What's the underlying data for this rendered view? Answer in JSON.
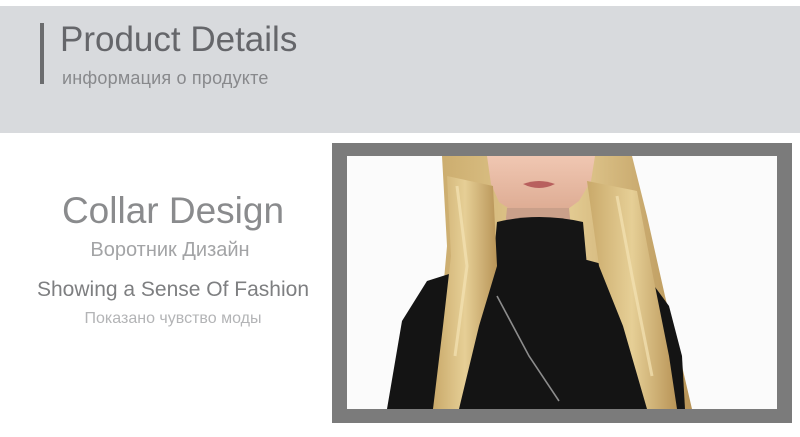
{
  "header": {
    "title": "Product Details",
    "subtitle": "информация о продукте"
  },
  "feature": {
    "title": "Collar Design",
    "subtitle": "Воротник Дизайн",
    "tagline": "Showing a Sense Of Fashion",
    "tagline_sub": "Показано чувство моды"
  },
  "colors": {
    "header_background": "#d8dadd",
    "frame": "#7b7b7b"
  }
}
